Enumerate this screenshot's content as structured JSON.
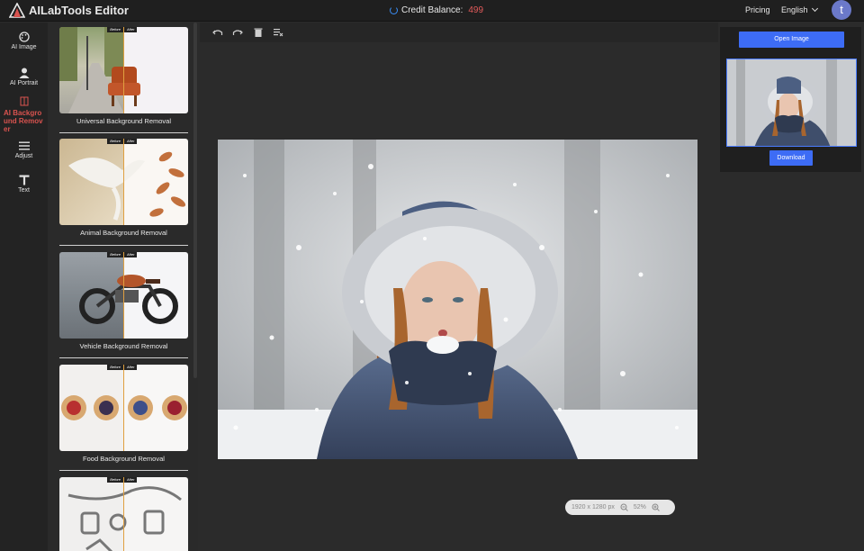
{
  "header": {
    "title": "AILabTools Editor",
    "credit_label": "Credit Balance:",
    "credit_value": "499",
    "pricing": "Pricing",
    "language": "English",
    "avatar_letter": "t"
  },
  "rail": {
    "items": [
      {
        "label": "AI Image",
        "icon": "palette-icon"
      },
      {
        "label": "AI Portrait",
        "icon": "person-icon"
      },
      {
        "label": "AI Backgro\nund Remov\ner",
        "icon": "background-remover-icon"
      },
      {
        "label": "Adjust",
        "icon": "menu-lines-icon"
      },
      {
        "label": "Text",
        "icon": "text-icon"
      }
    ]
  },
  "templates": {
    "before_tag": "Before",
    "after_tag": "After",
    "items": [
      {
        "label": "Universal Background Removal"
      },
      {
        "label": "Animal Background Removal"
      },
      {
        "label": "Vehicle Background Removal"
      },
      {
        "label": "Food Background Removal"
      },
      {
        "label": ""
      }
    ]
  },
  "canvas": {
    "dimensions": "1920 x 1280 px",
    "zoom": "52%"
  },
  "right_panel": {
    "open_label": "Open Image",
    "download_label": "Download"
  },
  "colors": {
    "accent_blue": "#3d6cf5",
    "active_red": "#d9534f",
    "credit_red": "#e25a5a"
  }
}
